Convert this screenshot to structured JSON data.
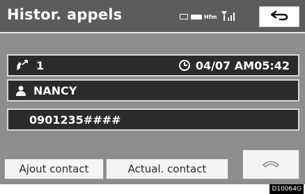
{
  "header": {
    "title": "Histor. appels",
    "status_text": "Hfm"
  },
  "entry": {
    "call_count": "1",
    "timestamp": "04/07 AM05:42",
    "contact_name": "NANCY",
    "phone_number": "0901235####"
  },
  "buttons": {
    "add_contact": "Ajout contact",
    "update_contact": "Actual. contact"
  },
  "figure_code": "D10064G",
  "icons": {
    "back": "back-arrow-icon",
    "call_direction": "outgoing-call-icon",
    "clock": "clock-icon",
    "person": "person-icon",
    "call": "handset-icon"
  }
}
